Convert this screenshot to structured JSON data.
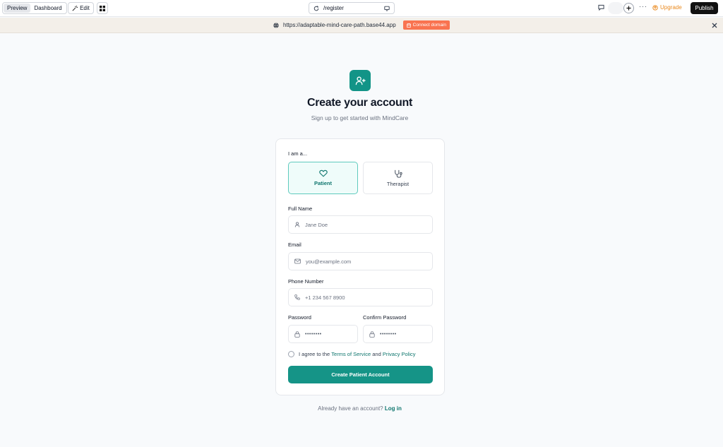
{
  "toolbar": {
    "preview_label": "Preview",
    "dashboard_label": "Dashboard",
    "edit_label": "Edit",
    "route": "/register",
    "upgrade_label": "Upgrade",
    "publish_label": "Publish",
    "more_label": "···"
  },
  "domain_bar": {
    "url": "https://adaptable-mind-care-path.base44.app",
    "connect_label": "Connect domain",
    "accent_color": "#f97350"
  },
  "header": {
    "title": "Create your account",
    "subtitle": "Sign up to get started with MindCare",
    "brand_color": "#129487"
  },
  "form": {
    "role_prompt": "I am a...",
    "roles": [
      {
        "label": "Patient",
        "icon": "heart-icon",
        "selected": true
      },
      {
        "label": "Therapist",
        "icon": "stethoscope-icon",
        "selected": false
      }
    ],
    "full_name": {
      "label": "Full Name",
      "placeholder": "Jane Doe",
      "icon": "user-icon"
    },
    "email": {
      "label": "Email",
      "placeholder": "you@example.com",
      "icon": "mail-icon"
    },
    "phone": {
      "label": "Phone Number",
      "placeholder": "+1 234 567 8900",
      "icon": "phone-icon"
    },
    "password": {
      "label": "Password",
      "placeholder": "••••••••",
      "icon": "lock-icon"
    },
    "confirm_password": {
      "label": "Confirm Password",
      "placeholder": "••••••••",
      "icon": "lock-icon"
    },
    "agree_prefix": "I agree to the",
    "terms_label": "Terms of Service",
    "agree_and": "and",
    "privacy_label": "Privacy Policy",
    "submit_label": "Create Patient Account"
  },
  "footer": {
    "prompt": "Already have an account?",
    "login_label": "Log in"
  }
}
